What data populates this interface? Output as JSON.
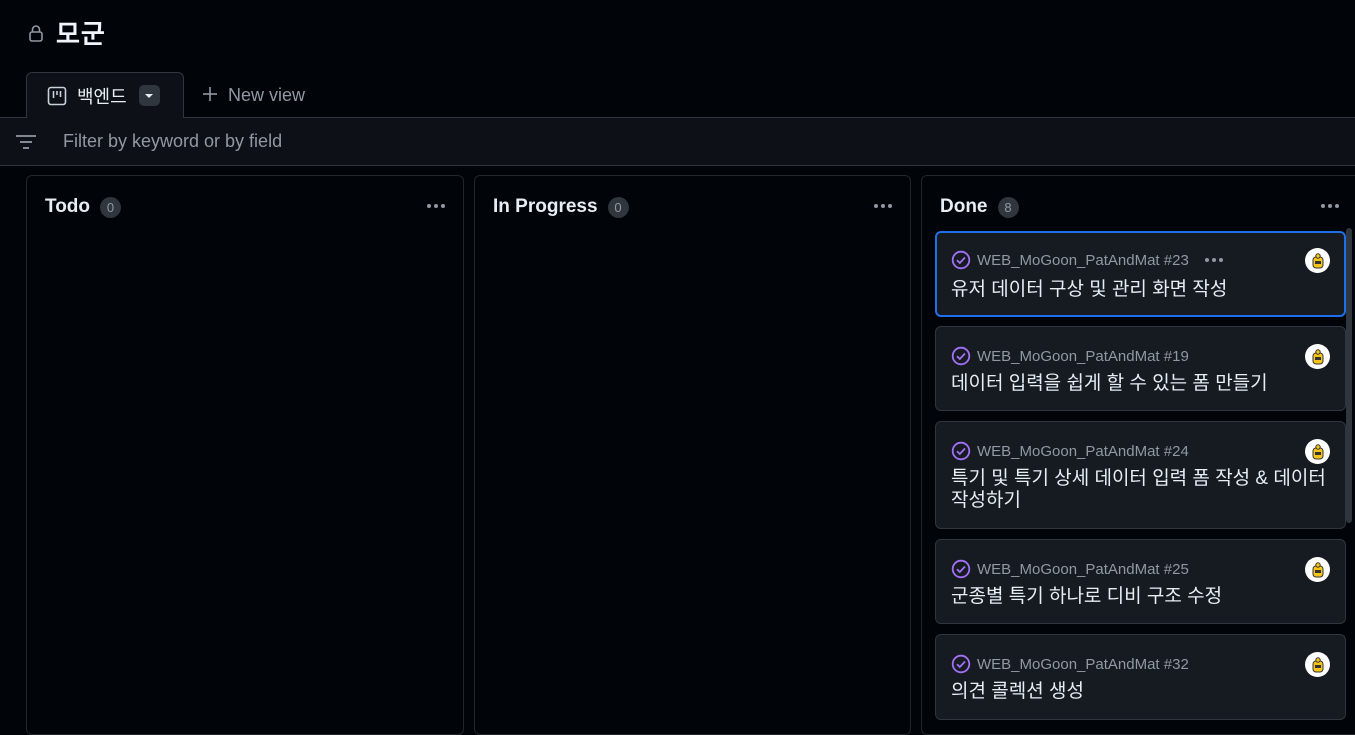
{
  "project": {
    "title": "모군",
    "icon": "lock-icon"
  },
  "tabs": [
    {
      "label": "백엔드",
      "icon": "board-icon",
      "active": true
    }
  ],
  "new_view_label": "New view",
  "filter": {
    "placeholder": "Filter by keyword or by field",
    "icon": "filter-icon"
  },
  "columns": [
    {
      "name": "Todo",
      "count": "0",
      "cards": []
    },
    {
      "name": "In Progress",
      "count": "0",
      "cards": []
    },
    {
      "name": "Done",
      "count": "8",
      "cards": [
        {
          "repo": "WEB_MoGoon_PatAndMat #23",
          "title": "유저 데이터 구상 및 관리 화면 작성",
          "selected": true
        },
        {
          "repo": "WEB_MoGoon_PatAndMat #19",
          "title": "데이터 입력을 쉽게 할 수 있는 폼 만들기"
        },
        {
          "repo": "WEB_MoGoon_PatAndMat #24",
          "title": "특기 및 특기 상세 데이터 입력 폼 작성 & 데이터 작성하기"
        },
        {
          "repo": "WEB_MoGoon_PatAndMat #25",
          "title": "군종별 특기 하나로 디비 구조 수정"
        },
        {
          "repo": "WEB_MoGoon_PatAndMat #32",
          "title": "의견 콜렉션 생성"
        }
      ]
    }
  ],
  "colors": {
    "accent": "#1f6feb",
    "done_purple": "#a371f7",
    "avatar_yellow": "#f5c518"
  }
}
